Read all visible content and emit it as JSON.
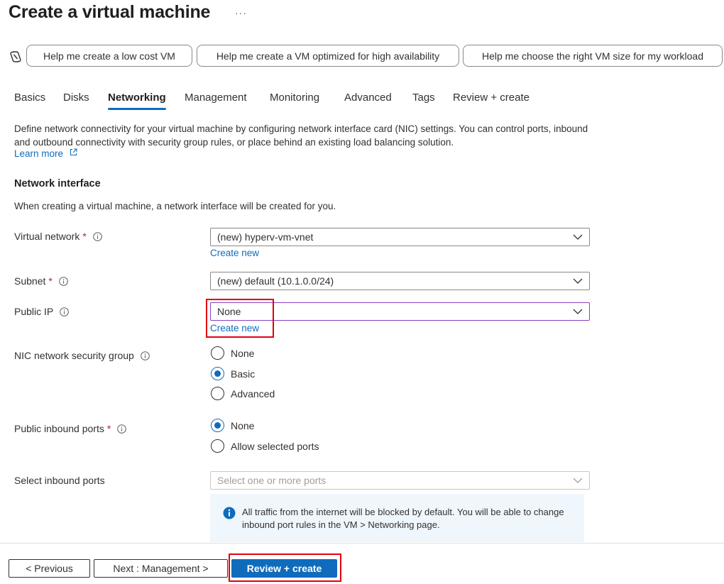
{
  "page": {
    "title": "Create a virtual machine",
    "more": "···"
  },
  "assist": {
    "chips": [
      "Help me create a low cost VM",
      "Help me create a VM optimized for high availability",
      "Help me choose the right VM size for my workload"
    ]
  },
  "tabs": [
    "Basics",
    "Disks",
    "Networking",
    "Management",
    "Monitoring",
    "Advanced",
    "Tags",
    "Review + create"
  ],
  "active_tab": "Networking",
  "intro": {
    "description": "Define network connectivity for your virtual machine by configuring network interface card (NIC) settings. You can control ports, inbound and outbound connectivity with security group rules, or place behind an existing load balancing solution.",
    "learn_more": "Learn more"
  },
  "network_interface": {
    "title": "Network interface",
    "description": "When creating a virtual machine, a network interface will be created for you.",
    "required_mark": "*",
    "virtual_network": {
      "label": "Virtual network",
      "value": "(new) hyperv-vm-vnet",
      "create_new": "Create new"
    },
    "subnet": {
      "label": "Subnet",
      "value": "(new) default (10.1.0.0/24)"
    },
    "public_ip": {
      "label": "Public IP",
      "value": "None",
      "create_new": "Create new"
    },
    "nic_nsg": {
      "label": "NIC network security group",
      "options": [
        "None",
        "Basic",
        "Advanced"
      ],
      "selected": "Basic"
    },
    "public_inbound_ports": {
      "label": "Public inbound ports",
      "options": [
        "None",
        "Allow selected ports"
      ],
      "selected": "None"
    },
    "select_inbound_ports": {
      "label": "Select inbound ports",
      "placeholder": "Select one or more ports"
    },
    "info": "All traffic from the internet will be blocked by default. You will be able to change inbound port rules in the VM > Networking page."
  },
  "footer": {
    "previous": "< Previous",
    "next": "Next : Management >",
    "review": "Review + create"
  },
  "colors": {
    "accent": "#0f6cbd",
    "highlight": "#e3000f",
    "required": "#a4262c",
    "focus_border": "#8b3fbf"
  }
}
